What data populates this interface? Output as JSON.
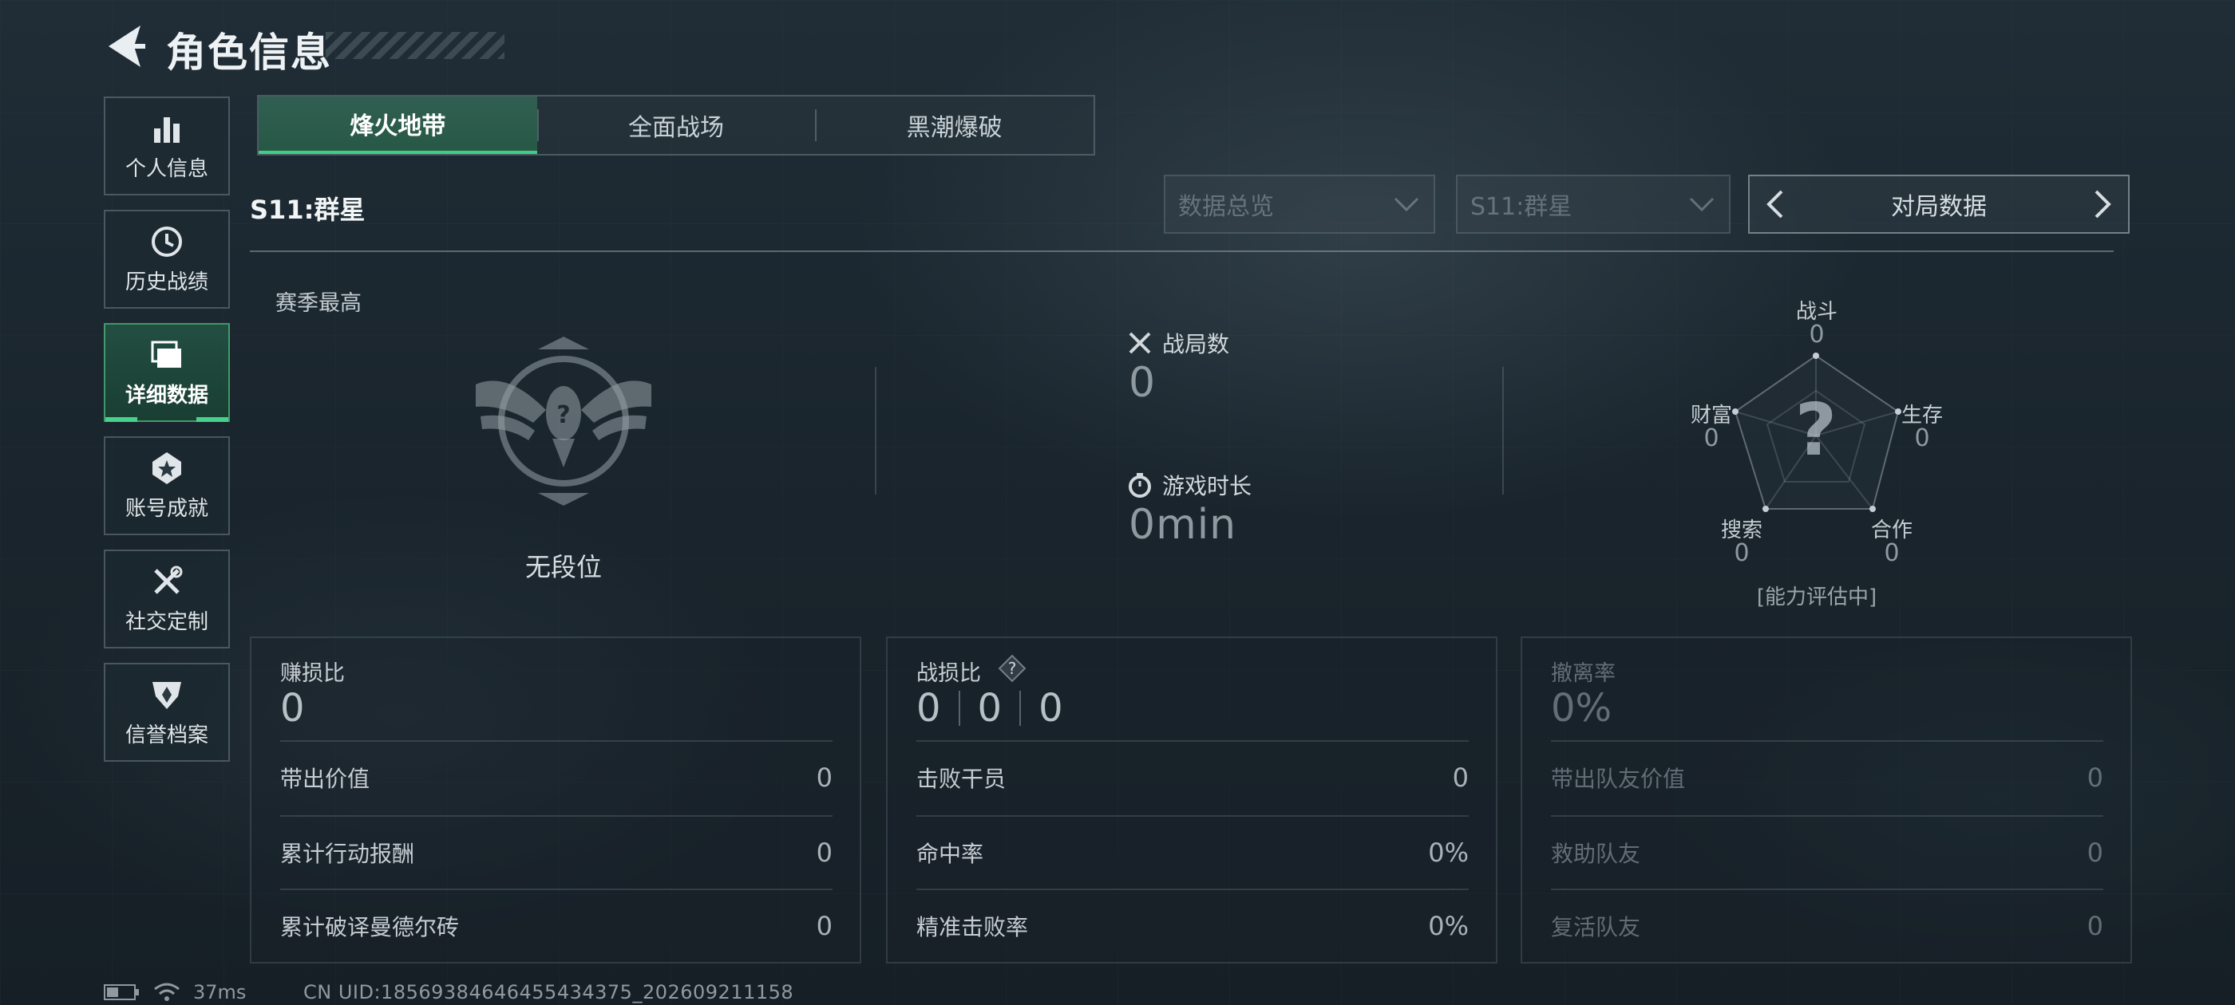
{
  "header": {
    "title": "角色信息"
  },
  "sidebar": {
    "items": [
      {
        "label": "个人信息",
        "icon": "bar-chart-icon",
        "active": false
      },
      {
        "label": "历史战绩",
        "icon": "history-clock-icon",
        "active": false
      },
      {
        "label": "详细数据",
        "icon": "stacked-cards-icon",
        "active": true
      },
      {
        "label": "账号成就",
        "icon": "medal-icon",
        "active": false
      },
      {
        "label": "社交定制",
        "icon": "tools-icon",
        "active": false
      },
      {
        "label": "信誉档案",
        "icon": "shield-badge-icon",
        "active": false
      }
    ]
  },
  "tabs": [
    {
      "label": "烽火地带",
      "active": true
    },
    {
      "label": "全面战场",
      "active": false
    },
    {
      "label": "黑潮爆破",
      "active": false
    }
  ],
  "season": {
    "title": "S11:群星"
  },
  "filters": {
    "dropdown_overview": "数据总览",
    "dropdown_season": "S11:群星",
    "pager_label": "对局数据"
  },
  "season_best": {
    "label": "赛季最高",
    "rank": "无段位"
  },
  "stats": {
    "matches_label": "战局数",
    "matches_value": "0",
    "playtime_label": "游戏时长",
    "playtime_value": "0min"
  },
  "radar": {
    "center_mark": "?",
    "combat_label": "战斗",
    "combat_value": "0",
    "survival_label": "生存",
    "survival_value": "0",
    "teamwork_label": "合作",
    "teamwork_value": "0",
    "search_label": "搜索",
    "search_value": "0",
    "wealth_label": "财富",
    "wealth_value": "0",
    "status": "[能力评估中]"
  },
  "panels": {
    "profit": {
      "head_label": "赚损比",
      "head_value": "0",
      "rows": [
        {
          "label": "带出价值",
          "value": "0"
        },
        {
          "label": "累计行动报酬",
          "value": "0"
        },
        {
          "label": "累计破译曼德尔砖",
          "value": "0"
        }
      ]
    },
    "combat": {
      "head_label": "战损比",
      "help": "?",
      "head_values": [
        "0",
        "0",
        "0"
      ],
      "rows": [
        {
          "label": "击败干员",
          "value": "0"
        },
        {
          "label": "命中率",
          "value": "0%"
        },
        {
          "label": "精准击败率",
          "value": "0%"
        }
      ]
    },
    "extract": {
      "head_label": "撤离率",
      "head_value": "0%",
      "rows": [
        {
          "label": "带出队友价值",
          "value": "0"
        },
        {
          "label": "救助队友",
          "value": "0"
        },
        {
          "label": "复活队友",
          "value": "0"
        }
      ]
    }
  },
  "status_bar": {
    "ping": "37ms",
    "uid": "CN UID:1856938464645543437­5_202609211158"
  },
  "colors": {
    "accent": "#3fcf86",
    "active_tab": "#2f7a5c",
    "background": "#1c2830"
  }
}
